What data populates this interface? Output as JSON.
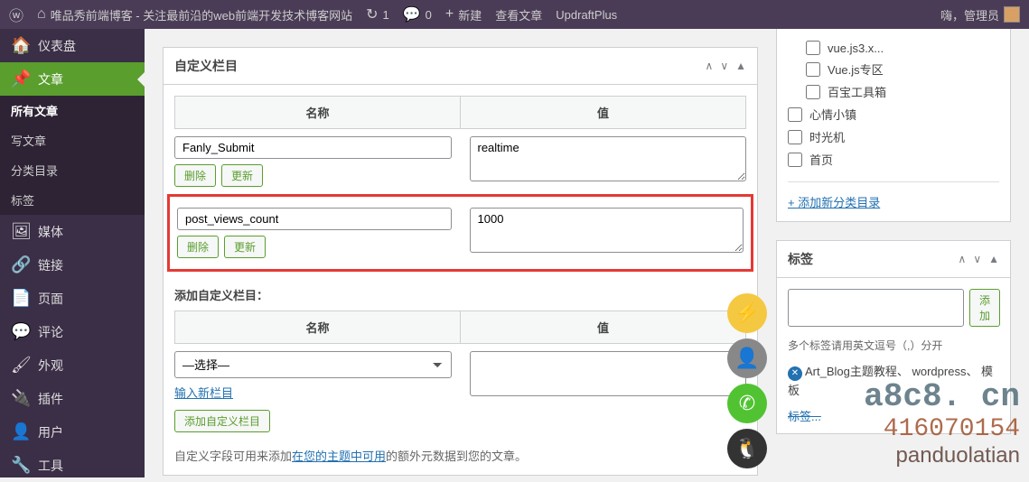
{
  "adminbar": {
    "site_title": "唯品秀前端博客 - 关注最前沿的web前端开发技术博客网站",
    "refresh_count": "1",
    "comment_count": "0",
    "new_label": "新建",
    "view_post": "查看文章",
    "updraft": "UpdraftPlus",
    "greeting": "嗨，管理员"
  },
  "sidebar": {
    "dashboard": "仪表盘",
    "posts": "文章",
    "all_posts": "所有文章",
    "new_post": "写文章",
    "categories": "分类目录",
    "tags": "标签",
    "media": "媒体",
    "links": "链接",
    "pages": "页面",
    "comments": "评论",
    "appearance": "外观",
    "plugins": "插件",
    "users": "用户",
    "tools": "工具"
  },
  "metabox": {
    "title": "自定义栏目",
    "th_name": "名称",
    "th_value": "值",
    "entries": [
      {
        "name": "Fanly_Submit",
        "value": "realtime"
      },
      {
        "name": "post_views_count",
        "value": "1000"
      }
    ],
    "btn_delete": "删除",
    "btn_update": "更新",
    "add_section_title": "添加自定义栏目：",
    "select_placeholder": "—选择—",
    "enter_new_link": "输入新栏目",
    "add_btn": "添加自定义栏目",
    "desc_prefix": "自定义字段可用来添加",
    "desc_link": "在您的主题中可用",
    "desc_suffix": "的额外元数据到您的文章。"
  },
  "rightcol": {
    "cats": [
      "Vue.js专区",
      "百宝工具箱",
      "心情小镇",
      "时光机",
      "首页"
    ],
    "cat_partial": "vue.js3.x...",
    "add_category": "+ 添加新分类目录",
    "tags_title": "标签",
    "add_btn": "添加",
    "tag_hint": "多个标签请用英文逗号（,）分开",
    "existing_tag": "Art_Blog主题教程、 wordpress、 模板",
    "link_below": "标签..."
  },
  "watermark": {
    "line1": "a8c8. cn",
    "line2": "416070154",
    "line3": "panduolatian"
  }
}
